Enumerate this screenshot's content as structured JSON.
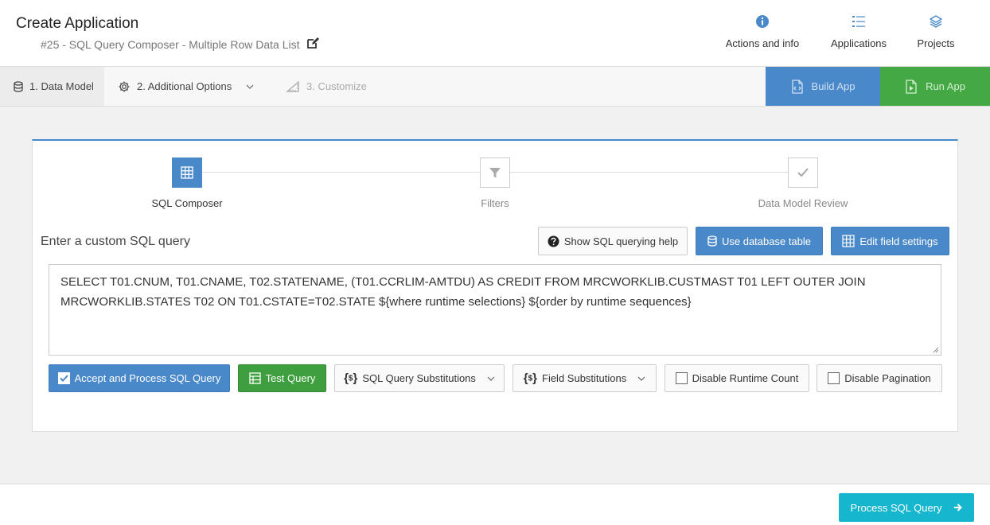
{
  "header": {
    "title": "Create Application",
    "subtitle": "#25 - SQL Query Composer - Multiple Row Data List",
    "actions": [
      {
        "label": "Actions and info",
        "icon": "info-icon"
      },
      {
        "label": "Applications",
        "icon": "list-icon"
      },
      {
        "label": "Projects",
        "icon": "layers-icon"
      }
    ]
  },
  "tabs": [
    {
      "label": "1. Data Model",
      "icon": "database-icon",
      "state": "active"
    },
    {
      "label": "2. Additional Options",
      "icon": "gear-icon",
      "state": "normal"
    },
    {
      "label": "3. Customize",
      "icon": "ruler-icon",
      "state": "disabled"
    }
  ],
  "build_label": "Build App",
  "run_label": "Run App",
  "steps": [
    {
      "label": "SQL Composer",
      "icon": "grid-icon",
      "state": "active"
    },
    {
      "label": "Filters",
      "icon": "filter-icon",
      "state": "normal"
    },
    {
      "label": "Data Model Review",
      "icon": "check-icon",
      "state": "normal"
    }
  ],
  "query": {
    "title": "Enter a custom SQL query",
    "help_label": "Show SQL querying help",
    "use_table_label": "Use database table",
    "edit_fields_label": "Edit field settings",
    "sql_text": "SELECT T01.CNUM, T01.CNAME, T02.STATENAME, (T01.CCRLIM-AMTDU) AS CREDIT FROM MRCWORKLIB.CUSTMAST T01 LEFT OUTER JOIN MRCWORKLIB.STATES T02 ON T01.CSTATE=T02.STATE  ${where runtime selections}  ${order by runtime sequences}"
  },
  "actions": {
    "accept_label": "Accept and Process SQL Query",
    "test_label": "Test Query",
    "sql_subs_label": "SQL Query Substitutions",
    "field_subs_label": "Field Substitutions",
    "disable_count_label": "Disable Runtime Count",
    "disable_pagination_label": "Disable Pagination"
  },
  "footer": {
    "process_label": "Process SQL Query"
  },
  "colors": {
    "primary_blue": "#4a89c9",
    "success_green": "#3e9f3e",
    "run_green": "#44a944",
    "process_cyan": "#17b6cf"
  }
}
